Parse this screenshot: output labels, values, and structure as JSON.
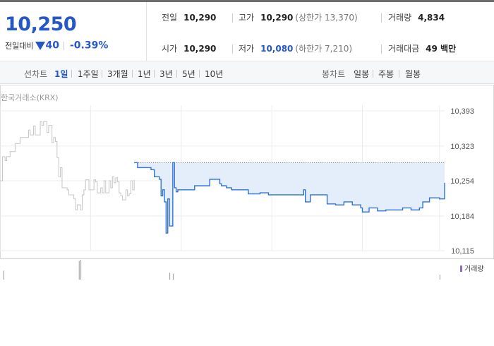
{
  "summary": {
    "price": "10,250",
    "change_label": "전일대비",
    "change_value": "40",
    "change_rate": "-0.39%",
    "prev_close_label": "전일",
    "prev_close": "10,290",
    "open_label": "시가",
    "open": "10,290",
    "high_label": "고가",
    "high": "10,290",
    "upper_limit": "(상한가 13,370)",
    "low_label": "저가",
    "low": "10,080",
    "lower_limit": "(하한가 7,210)",
    "volume_label": "거래량",
    "volume": "4,834",
    "amount_label": "거래대금",
    "amount": "49 백만"
  },
  "tabs": {
    "line_label": "선차트",
    "line_items": [
      "1일",
      "1주일",
      "3개월",
      "1년",
      "3년",
      "5년",
      "10년"
    ],
    "candle_label": "봉차트",
    "candle_items": [
      "일봉",
      "주봉",
      "월봉"
    ],
    "active": "1일"
  },
  "chart_data": {
    "type": "line",
    "source_label": "한국거래소(KRX)",
    "yticks": [
      "10,393",
      "10,323",
      "10,254",
      "10,184",
      "10,115"
    ],
    "ylim": [
      10115,
      10393
    ],
    "reference_line": 10290,
    "reference_label": "",
    "legend": "거래량",
    "colors": {
      "line": "#2f73d8",
      "fill": "#e4edfa",
      "history": "#c6c6c6",
      "grid": "#ececec"
    },
    "series": [
      {
        "role": "previous",
        "x": [
          0,
          1.5,
          3,
          4,
          6,
          9,
          11,
          12,
          15,
          17,
          18,
          20,
          21,
          24,
          25,
          26,
          28,
          29,
          31,
          32,
          33,
          34,
          35,
          36,
          37,
          40,
          41,
          42,
          44,
          45,
          46,
          48,
          49,
          50,
          51,
          52,
          53,
          55,
          56,
          57,
          58,
          60,
          61,
          62,
          63,
          65,
          66,
          67,
          68,
          69,
          70,
          71,
          72,
          73,
          75,
          76,
          77,
          78,
          79,
          80
        ],
        "y": [
          10254,
          10302,
          10294,
          10302,
          10312,
          10328,
          10328,
          10340,
          10340,
          10355,
          10345,
          10363,
          10345,
          10372,
          10364,
          10372,
          10350,
          10364,
          10330,
          10340,
          10332,
          10300,
          10262,
          10280,
          10240,
          10236,
          10226,
          10226,
          10218,
          10196,
          10206,
          10196,
          10226,
          10236,
          10256,
          10256,
          10236,
          10236,
          10256,
          10252,
          10230,
          10240,
          10230,
          10254,
          10230,
          10254,
          10240,
          10262,
          10250,
          10260,
          10252,
          10230,
          10224,
          10216,
          10236,
          10224,
          10228,
          10254,
          10236,
          10256
        ]
      },
      {
        "role": "today",
        "x": [
          80,
          82,
          86,
          90,
          92,
          95,
          96,
          97,
          98,
          99,
          100,
          101,
          102,
          103,
          104,
          105,
          106,
          108,
          110,
          116,
          118,
          120,
          125,
          127,
          130,
          131,
          132,
          135,
          138,
          142,
          148,
          155,
          160,
          165,
          170,
          180,
          181,
          182,
          185,
          190,
          195,
          200,
          205,
          210,
          215,
          216,
          220,
          225,
          230,
          235,
          240,
          245,
          250,
          252,
          256,
          262,
          265
        ],
        "y": [
          10290,
          10280,
          10280,
          10276,
          10262,
          10257,
          10224,
          10236,
          10212,
          10150,
          10218,
          10164,
          10164,
          10290,
          10240,
          10232,
          10236,
          10236,
          10236,
          10244,
          10244,
          10244,
          10257,
          10257,
          10257,
          10248,
          10244,
          10240,
          10236,
          10236,
          10228,
          10230,
          10226,
          10226,
          10226,
          10226,
          10236,
          10212,
          10226,
          10226,
          10208,
          10206,
          10212,
          10206,
          10200,
          10192,
          10200,
          10194,
          10196,
          10196,
          10200,
          10196,
          10200,
          10212,
          10220,
          10218,
          10250
        ]
      }
    ],
    "volume": [
      {
        "x": 2,
        "v": 0.45
      },
      {
        "x": 47,
        "v": 0.95
      },
      {
        "x": 48,
        "v": 1.0
      },
      {
        "x": 101,
        "v": 0.35
      },
      {
        "x": 103,
        "v": 0.3
      },
      {
        "x": 262,
        "v": 0.25
      }
    ],
    "x_grid": [
      0,
      54,
      108,
      162,
      216,
      262
    ]
  }
}
